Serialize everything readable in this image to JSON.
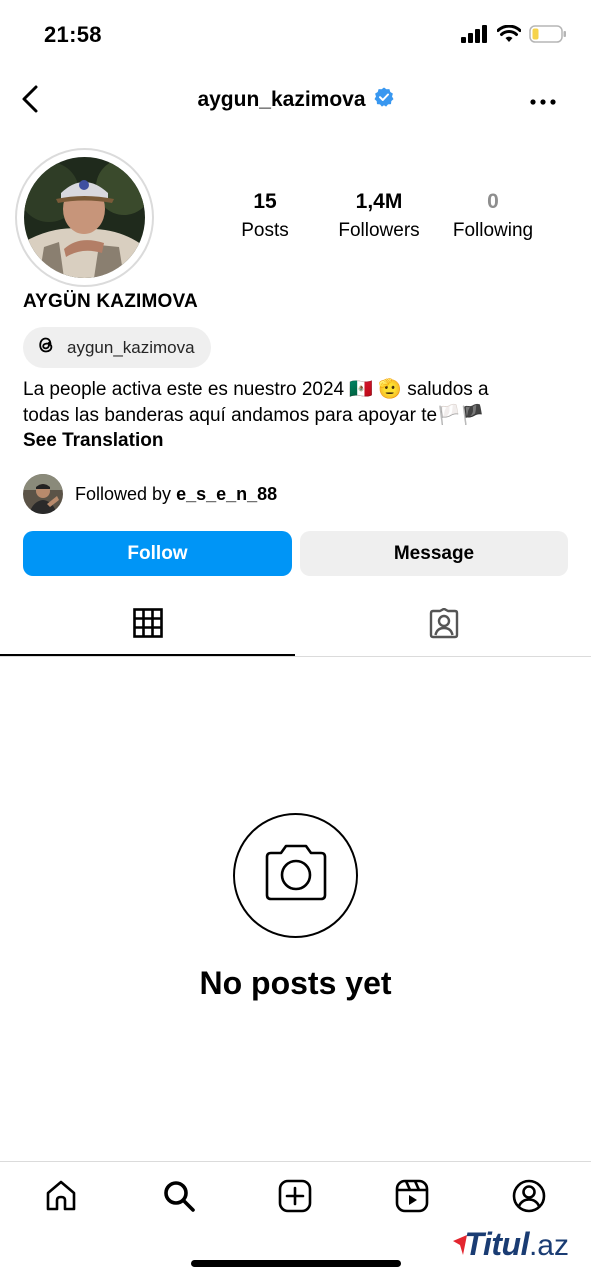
{
  "status_bar": {
    "time": "21:58"
  },
  "header": {
    "username": "aygun_kazimova",
    "verified_icon": "verified-badge-icon",
    "back_icon": "chevron-left-icon",
    "more_icon": "more-horizontal-icon"
  },
  "profile": {
    "stats": [
      {
        "value": "15",
        "label": "Posts"
      },
      {
        "value": "1,4M",
        "label": "Followers"
      },
      {
        "value": "0",
        "label": "Following"
      }
    ],
    "display_name": "AYGÜN KAZIMOVA",
    "threads_handle": "aygun_kazimova",
    "bio_line1": "La people activa este es nuestro 2024 🇲🇽 🫡 saludos a",
    "bio_line2": "todas las banderas aquí andamos para apoyar te🏳️🏴",
    "see_translation": "See Translation",
    "followed_by_prefix": "Followed by ",
    "followed_by_user": "e_s_e_n_88"
  },
  "actions": {
    "follow": "Follow",
    "message": "Message"
  },
  "tabs": [
    {
      "icon": "grid-icon",
      "active": true
    },
    {
      "icon": "tagged-user-icon",
      "active": false
    }
  ],
  "empty_state": {
    "icon": "camera-icon",
    "title": "No posts yet"
  },
  "bottom_nav": [
    "home-icon",
    "search-icon",
    "create-icon",
    "reels-icon",
    "profile-icon"
  ],
  "watermark": {
    "main": "Titul",
    "tld": ".az"
  },
  "colors": {
    "primary_blue": "#0095f6",
    "button_gray": "#efefef",
    "verified_blue": "#3897f0",
    "watermark_navy": "#1a3c73",
    "watermark_red": "#e3262f"
  }
}
